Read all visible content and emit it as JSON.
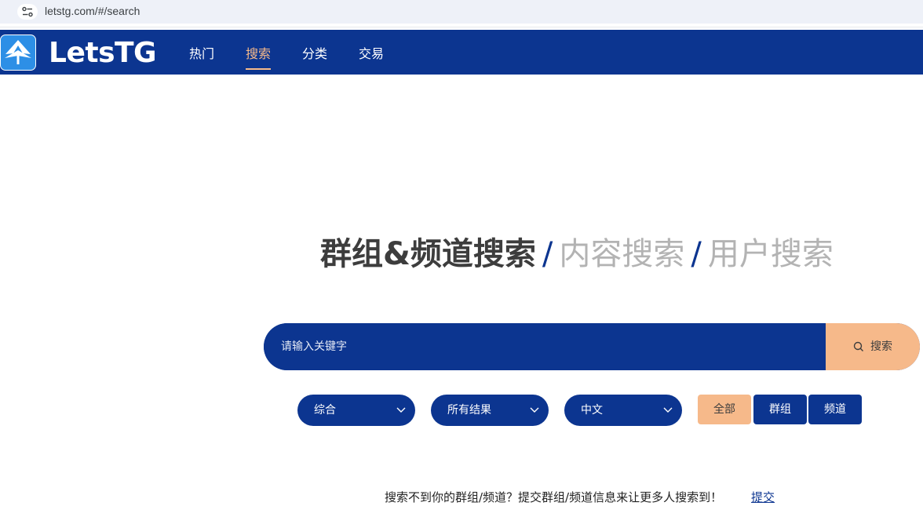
{
  "browser": {
    "url": "letstg.com/#/search",
    "site_info_icon": "tune-icon"
  },
  "header": {
    "logo_icon": "paper-plane-icon",
    "logo_text": "LetsTG",
    "nav": [
      {
        "label": "热门",
        "active": false
      },
      {
        "label": "搜索",
        "active": true
      },
      {
        "label": "分类",
        "active": false
      },
      {
        "label": "交易",
        "active": false
      }
    ]
  },
  "heading": {
    "active": "群组&频道搜索",
    "separator": "/",
    "content_search": "内容搜索",
    "user_search": "用户搜索"
  },
  "search": {
    "placeholder": "请输入关键字",
    "value": "",
    "button_label": "搜索",
    "button_icon": "search-icon"
  },
  "filters": {
    "dropdowns": [
      {
        "label": "综合"
      },
      {
        "label": "所有结果"
      },
      {
        "label": "中文"
      }
    ],
    "type_buttons": [
      {
        "label": "全部",
        "active": true
      },
      {
        "label": "群组",
        "active": false
      },
      {
        "label": "频道",
        "active": false
      }
    ]
  },
  "footer": {
    "note": "搜索不到你的群组/频道？提交群组/频道信息来让更多人搜索到！",
    "link": "提交"
  },
  "colors": {
    "primary": "#0c3590",
    "accent": "#f6b98a",
    "heading_active": "#3d3d3d",
    "heading_inactive": "#b3b3b3"
  }
}
